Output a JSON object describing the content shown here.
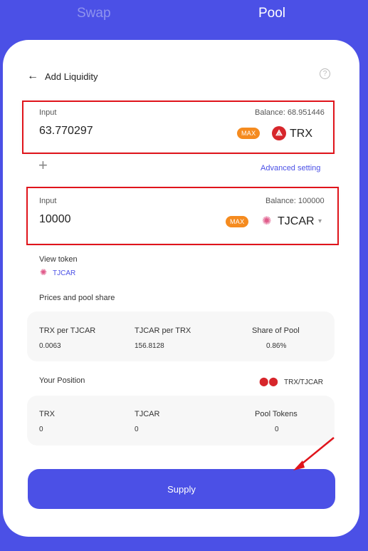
{
  "tabs": {
    "swap": "Swap",
    "pool": "Pool"
  },
  "header": {
    "back_icon": "←",
    "title": "Add Liquidity",
    "help_icon": "?"
  },
  "input1": {
    "label": "Input",
    "balance": "Balance: 68.951446",
    "amount": "63.770297",
    "max": "MAX",
    "token": "TRX"
  },
  "plus_icon": "+",
  "advanced_setting": "Advanced setting",
  "input2": {
    "label": "Input",
    "balance": "Balance: 100000",
    "amount": "10000",
    "max": "MAX",
    "token": "TJCAR",
    "caret": "▾"
  },
  "view_token": {
    "label": "View token",
    "token": "TJCAR"
  },
  "prices": {
    "heading": "Prices and pool share",
    "cols": [
      {
        "label": "TRX per TJCAR",
        "value": "0.0063"
      },
      {
        "label": "TJCAR per TRX",
        "value": "156.8128"
      },
      {
        "label": "Share of Pool",
        "value": "0.86%"
      }
    ]
  },
  "position": {
    "heading": "Your Position",
    "pair": "TRX/TJCAR",
    "cols": [
      {
        "label": "TRX",
        "value": "0"
      },
      {
        "label": "TJCAR",
        "value": "0"
      },
      {
        "label": "Pool Tokens",
        "value": "0"
      }
    ]
  },
  "supply_label": "Supply",
  "colors": {
    "accent": "#4b50e6",
    "highlight": "#e0141b",
    "max_badge": "#f58b1f",
    "trx": "#d7262b"
  }
}
